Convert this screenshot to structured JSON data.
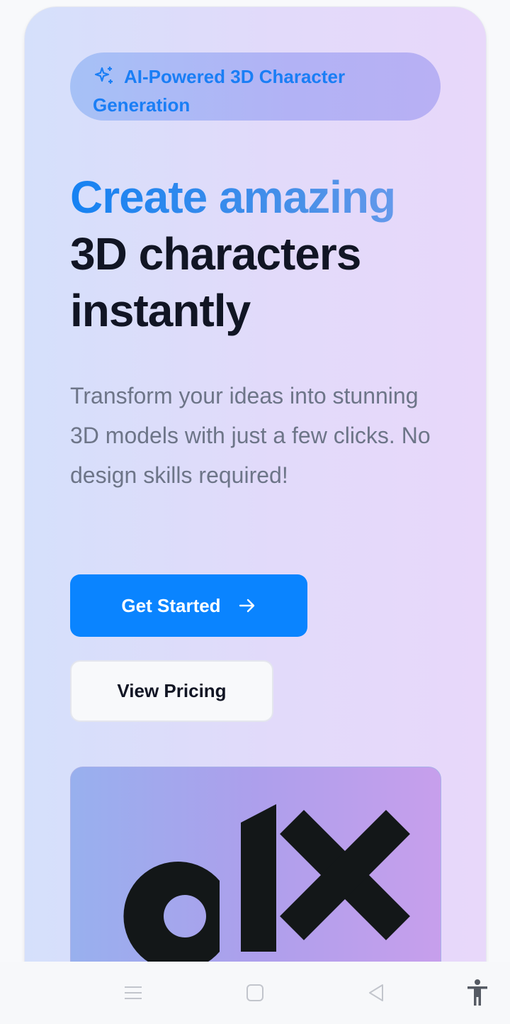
{
  "hero": {
    "badge_icon": "sparkles-icon",
    "badge_text": "AI-Powered 3D Character Generation",
    "headline_accent": "Create amazing",
    "headline_line2": "3D characters",
    "headline_line3": "instantly",
    "subtitle": "Transform your ideas into stunning 3D models with just a few clicks. No design skills required!",
    "primary_button": "Get Started",
    "primary_button_icon": "arrow-right-icon",
    "secondary_button": "View Pricing",
    "image_logo_text": "alx"
  },
  "nav_bar": {
    "items": [
      "menu-icon",
      "home-square-icon",
      "back-triangle-icon",
      "accessibility-icon"
    ]
  },
  "colors": {
    "accent_blue": "#0a84ff",
    "badge_text": "#1a7ef5",
    "headline_dark": "#111524",
    "subtitle_gray": "#6d7588",
    "logo_dark": "#131718"
  }
}
